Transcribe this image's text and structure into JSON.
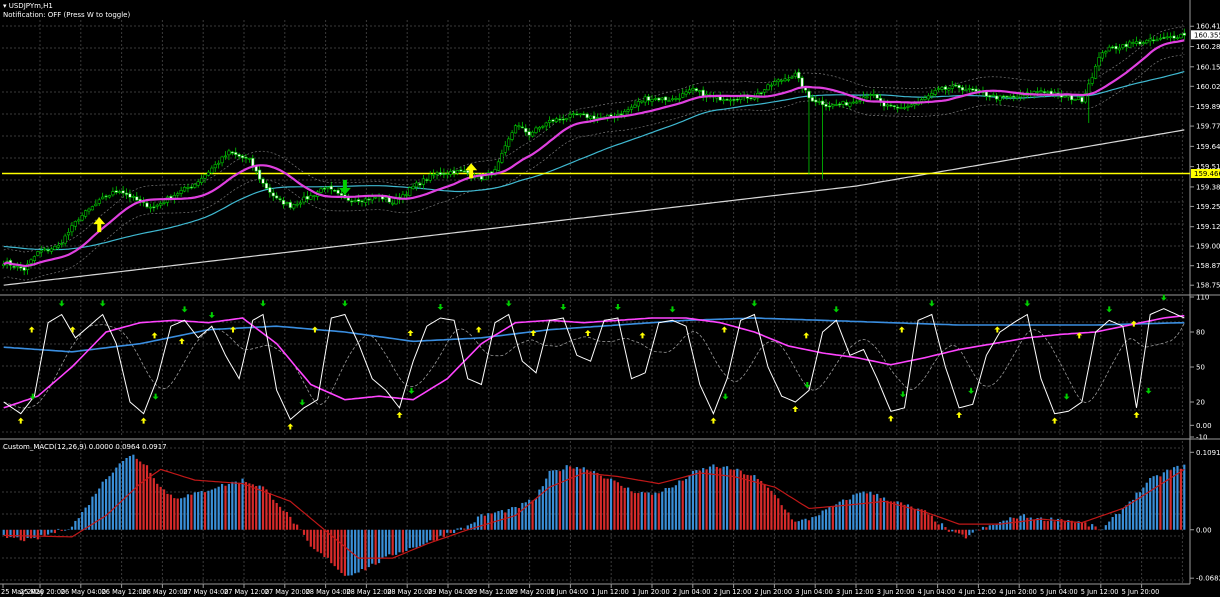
{
  "header": {
    "symbol": "▾ USDJPYm,H1",
    "notification": "Notification: OFF (Press W to toggle)"
  },
  "colors": {
    "background": "#000000",
    "grid": "#3a3a3a",
    "bull_candle": "#00c800",
    "bear_candle": "#ffffff",
    "ma_fast": "#e040e0",
    "ma_mid": "#3fb8d0",
    "ma_slow": "#d8d8d8",
    "level_line": "#ffff00",
    "macd_up": "#3a8fd8",
    "macd_down": "#d82a2a",
    "signal": "#c01818",
    "arrow_up": "#ffff00",
    "arrow_down": "#00d000",
    "stoch_main": "#ffffff",
    "stoch_signal": "#ff44ff",
    "stoch_slow": "#3a8ee0"
  },
  "chart_data": [
    {
      "type": "candlestick",
      "panel": "price",
      "symbol": "USDJPYm",
      "timeframe": "H1",
      "ylim": [
        158.7,
        160.45
      ],
      "yticks": [
        "160.410",
        "160.280",
        "160.150",
        "160.025",
        "159.895",
        "159.770",
        "159.640",
        "159.510",
        "159.380",
        "159.255",
        "159.125",
        "159.000",
        "158.875",
        "158.750"
      ],
      "current_price": "160.355",
      "level": {
        "value": 159.466,
        "label": "159.466"
      },
      "close_anchors": [
        [
          0,
          158.9
        ],
        [
          6,
          158.85
        ],
        [
          10,
          158.96
        ],
        [
          16,
          159.0
        ],
        [
          22,
          159.18
        ],
        [
          30,
          159.32
        ],
        [
          34,
          159.36
        ],
        [
          40,
          159.28
        ],
        [
          44,
          159.25
        ],
        [
          50,
          159.33
        ],
        [
          56,
          159.4
        ],
        [
          62,
          159.52
        ],
        [
          66,
          159.6
        ],
        [
          72,
          159.55
        ],
        [
          76,
          159.4
        ],
        [
          80,
          159.3
        ],
        [
          84,
          159.26
        ],
        [
          90,
          159.32
        ],
        [
          94,
          159.38
        ],
        [
          100,
          159.3
        ],
        [
          106,
          159.3
        ],
        [
          110,
          159.32
        ],
        [
          114,
          159.28
        ],
        [
          120,
          159.38
        ],
        [
          126,
          159.46
        ],
        [
          132,
          159.48
        ],
        [
          136,
          159.47
        ],
        [
          140,
          159.44
        ],
        [
          144,
          159.48
        ],
        [
          150,
          159.78
        ],
        [
          154,
          159.72
        ],
        [
          160,
          159.8
        ],
        [
          168,
          159.84
        ],
        [
          176,
          159.82
        ],
        [
          182,
          159.86
        ],
        [
          188,
          159.95
        ],
        [
          196,
          159.94
        ],
        [
          202,
          160.0
        ],
        [
          208,
          159.95
        ],
        [
          214,
          159.95
        ],
        [
          220,
          159.96
        ],
        [
          226,
          160.05
        ],
        [
          232,
          160.1
        ],
        [
          236,
          159.95
        ],
        [
          242,
          159.9
        ],
        [
          248,
          159.92
        ],
        [
          254,
          159.98
        ],
        [
          258,
          159.9
        ],
        [
          262,
          159.88
        ],
        [
          268,
          159.92
        ],
        [
          274,
          160.0
        ],
        [
          280,
          160.02
        ],
        [
          286,
          159.98
        ],
        [
          292,
          159.95
        ],
        [
          298,
          159.96
        ],
        [
          304,
          160.0
        ],
        [
          310,
          159.96
        ],
        [
          316,
          159.94
        ],
        [
          322,
          160.25
        ],
        [
          330,
          160.3
        ],
        [
          338,
          160.32
        ],
        [
          346,
          160.36
        ]
      ],
      "spikes": [
        {
          "bar": 236,
          "low": 159.46
        },
        {
          "bar": 240,
          "low": 159.43
        },
        {
          "bar": 318,
          "low": 159.79
        }
      ],
      "arrows": [
        {
          "bar": 28,
          "dir": "up"
        },
        {
          "bar": 100,
          "dir": "down"
        },
        {
          "bar": 137,
          "dir": "up"
        }
      ]
    },
    {
      "type": "line",
      "panel": "stochastic",
      "ylim": [
        -10,
        110
      ],
      "yticks": [
        "110",
        "80",
        "50",
        "20",
        "0.00",
        "-10"
      ],
      "main_anchors": [
        [
          0,
          20
        ],
        [
          5,
          10
        ],
        [
          9,
          25
        ],
        [
          13,
          88
        ],
        [
          17,
          95
        ],
        [
          21,
          75
        ],
        [
          25,
          85
        ],
        [
          29,
          95
        ],
        [
          33,
          70
        ],
        [
          37,
          20
        ],
        [
          41,
          10
        ],
        [
          45,
          40
        ],
        [
          49,
          85
        ],
        [
          53,
          90
        ],
        [
          57,
          75
        ],
        [
          61,
          85
        ],
        [
          65,
          60
        ],
        [
          69,
          40
        ],
        [
          73,
          90
        ],
        [
          76,
          95
        ],
        [
          80,
          30
        ],
        [
          84,
          5
        ],
        [
          88,
          15
        ],
        [
          92,
          22
        ],
        [
          96,
          92
        ],
        [
          100,
          95
        ],
        [
          104,
          70
        ],
        [
          108,
          40
        ],
        [
          112,
          30
        ],
        [
          116,
          15
        ],
        [
          120,
          55
        ],
        [
          124,
          85
        ],
        [
          128,
          92
        ],
        [
          132,
          90
        ],
        [
          136,
          40
        ],
        [
          140,
          35
        ],
        [
          144,
          88
        ],
        [
          148,
          95
        ],
        [
          152,
          55
        ],
        [
          156,
          45
        ],
        [
          160,
          90
        ],
        [
          164,
          92
        ],
        [
          168,
          60
        ],
        [
          172,
          55
        ],
        [
          176,
          90
        ],
        [
          180,
          92
        ],
        [
          184,
          40
        ],
        [
          188,
          45
        ],
        [
          192,
          88
        ],
        [
          196,
          90
        ],
        [
          200,
          85
        ],
        [
          204,
          35
        ],
        [
          208,
          10
        ],
        [
          212,
          40
        ],
        [
          216,
          90
        ],
        [
          220,
          95
        ],
        [
          224,
          50
        ],
        [
          228,
          25
        ],
        [
          232,
          20
        ],
        [
          236,
          30
        ],
        [
          240,
          80
        ],
        [
          244,
          90
        ],
        [
          248,
          60
        ],
        [
          252,
          65
        ],
        [
          256,
          40
        ],
        [
          260,
          12
        ],
        [
          264,
          15
        ],
        [
          268,
          90
        ],
        [
          272,
          95
        ],
        [
          276,
          50
        ],
        [
          280,
          15
        ],
        [
          284,
          18
        ],
        [
          288,
          60
        ],
        [
          292,
          80
        ],
        [
          296,
          88
        ],
        [
          300,
          95
        ],
        [
          304,
          40
        ],
        [
          308,
          10
        ],
        [
          312,
          12
        ],
        [
          316,
          20
        ],
        [
          320,
          80
        ],
        [
          324,
          90
        ],
        [
          328,
          85
        ],
        [
          332,
          15
        ],
        [
          336,
          95
        ],
        [
          340,
          100
        ],
        [
          346,
          92
        ]
      ],
      "signal_anchors": [
        [
          0,
          15
        ],
        [
          10,
          25
        ],
        [
          20,
          50
        ],
        [
          30,
          80
        ],
        [
          40,
          88
        ],
        [
          50,
          90
        ],
        [
          60,
          88
        ],
        [
          70,
          92
        ],
        [
          80,
          70
        ],
        [
          90,
          35
        ],
        [
          100,
          22
        ],
        [
          110,
          25
        ],
        [
          120,
          22
        ],
        [
          130,
          40
        ],
        [
          140,
          70
        ],
        [
          150,
          88
        ],
        [
          160,
          90
        ],
        [
          170,
          88
        ],
        [
          180,
          90
        ],
        [
          190,
          92
        ],
        [
          200,
          92
        ],
        [
          210,
          88
        ],
        [
          220,
          80
        ],
        [
          230,
          68
        ],
        [
          240,
          62
        ],
        [
          250,
          58
        ],
        [
          260,
          52
        ],
        [
          270,
          58
        ],
        [
          280,
          65
        ],
        [
          290,
          70
        ],
        [
          300,
          75
        ],
        [
          310,
          78
        ],
        [
          320,
          80
        ],
        [
          330,
          86
        ],
        [
          340,
          92
        ],
        [
          346,
          94
        ]
      ],
      "slow_anchors": [
        [
          0,
          67
        ],
        [
          20,
          63
        ],
        [
          40,
          70
        ],
        [
          60,
          82
        ],
        [
          80,
          85
        ],
        [
          100,
          80
        ],
        [
          120,
          72
        ],
        [
          140,
          75
        ],
        [
          160,
          82
        ],
        [
          180,
          86
        ],
        [
          200,
          90
        ],
        [
          220,
          92
        ],
        [
          240,
          90
        ],
        [
          260,
          88
        ],
        [
          280,
          86
        ],
        [
          300,
          86
        ],
        [
          320,
          86
        ],
        [
          346,
          88
        ]
      ]
    },
    {
      "type": "bar",
      "panel": "macd",
      "title": "Custom_MACD(12,26,9) 0.0000 0.0964 0.0917",
      "ylim": [
        -0.075,
        0.125
      ],
      "yticks": [
        "0.1091",
        "0.00",
        "-0.0682"
      ],
      "hist_anchors": [
        [
          0,
          -0.01
        ],
        [
          8,
          -0.015
        ],
        [
          14,
          -0.005
        ],
        [
          20,
          0.005
        ],
        [
          24,
          0.03
        ],
        [
          28,
          0.06
        ],
        [
          34,
          0.095
        ],
        [
          38,
          0.105
        ],
        [
          42,
          0.09
        ],
        [
          46,
          0.06
        ],
        [
          50,
          0.045
        ],
        [
          56,
          0.05
        ],
        [
          62,
          0.06
        ],
        [
          70,
          0.07
        ],
        [
          76,
          0.06
        ],
        [
          80,
          0.04
        ],
        [
          86,
          0.005
        ],
        [
          90,
          -0.025
        ],
        [
          96,
          -0.045
        ],
        [
          100,
          -0.065
        ],
        [
          106,
          -0.055
        ],
        [
          110,
          -0.045
        ],
        [
          114,
          -0.035
        ],
        [
          120,
          -0.025
        ],
        [
          126,
          -0.015
        ],
        [
          130,
          -0.005
        ],
        [
          136,
          0.005
        ],
        [
          140,
          0.02
        ],
        [
          150,
          0.03
        ],
        [
          156,
          0.045
        ],
        [
          160,
          0.08
        ],
        [
          166,
          0.09
        ],
        [
          172,
          0.085
        ],
        [
          178,
          0.07
        ],
        [
          184,
          0.055
        ],
        [
          190,
          0.05
        ],
        [
          196,
          0.06
        ],
        [
          202,
          0.08
        ],
        [
          208,
          0.09
        ],
        [
          214,
          0.085
        ],
        [
          220,
          0.075
        ],
        [
          226,
          0.05
        ],
        [
          232,
          0.01
        ],
        [
          236,
          0.015
        ],
        [
          242,
          0.03
        ],
        [
          248,
          0.045
        ],
        [
          252,
          0.055
        ],
        [
          258,
          0.045
        ],
        [
          264,
          0.035
        ],
        [
          270,
          0.025
        ],
        [
          274,
          0.01
        ],
        [
          278,
          -0.005
        ],
        [
          282,
          -0.01
        ],
        [
          286,
          0.0
        ],
        [
          292,
          0.01
        ],
        [
          298,
          0.02
        ],
        [
          304,
          0.015
        ],
        [
          310,
          0.015
        ],
        [
          316,
          0.01
        ],
        [
          322,
          0.0
        ],
        [
          326,
          0.02
        ],
        [
          330,
          0.04
        ],
        [
          336,
          0.07
        ],
        [
          342,
          0.085
        ],
        [
          346,
          0.09
        ]
      ],
      "signal_anchors": [
        [
          0,
          -0.008
        ],
        [
          20,
          -0.01
        ],
        [
          30,
          0.02
        ],
        [
          40,
          0.065
        ],
        [
          46,
          0.085
        ],
        [
          56,
          0.07
        ],
        [
          70,
          0.065
        ],
        [
          84,
          0.04
        ],
        [
          94,
          0.0
        ],
        [
          104,
          -0.04
        ],
        [
          114,
          -0.04
        ],
        [
          124,
          -0.02
        ],
        [
          136,
          0.0
        ],
        [
          150,
          0.02
        ],
        [
          160,
          0.06
        ],
        [
          170,
          0.08
        ],
        [
          180,
          0.075
        ],
        [
          192,
          0.065
        ],
        [
          204,
          0.08
        ],
        [
          214,
          0.075
        ],
        [
          226,
          0.06
        ],
        [
          236,
          0.03
        ],
        [
          248,
          0.035
        ],
        [
          258,
          0.04
        ],
        [
          270,
          0.025
        ],
        [
          280,
          0.008
        ],
        [
          292,
          0.008
        ],
        [
          304,
          0.015
        ],
        [
          316,
          0.01
        ],
        [
          328,
          0.03
        ],
        [
          346,
          0.085
        ]
      ]
    }
  ],
  "time_labels": [
    "25 May 2026",
    "25 May 20:00",
    "26 May 04:00",
    "26 May 12:00",
    "26 May 20:00",
    "27 May 04:00",
    "27 May 12:00",
    "27 May 20:00",
    "28 May 04:00",
    "28 May 12:00",
    "28 May 20:00",
    "29 May 04:00",
    "29 May 12:00",
    "29 May 20:00",
    "1 Jun 04:00",
    "1 Jun 12:00",
    "1 Jun 20:00",
    "2 Jun 04:00",
    "2 Jun 12:00",
    "2 Jun 20:00",
    "3 Jun 04:00",
    "3 Jun 12:00",
    "3 Jun 20:00",
    "4 Jun 04:00",
    "4 Jun 12:00",
    "4 Jun 20:00",
    "5 Jun 04:00",
    "5 Jun 12:00",
    "5 Jun 20:00"
  ]
}
